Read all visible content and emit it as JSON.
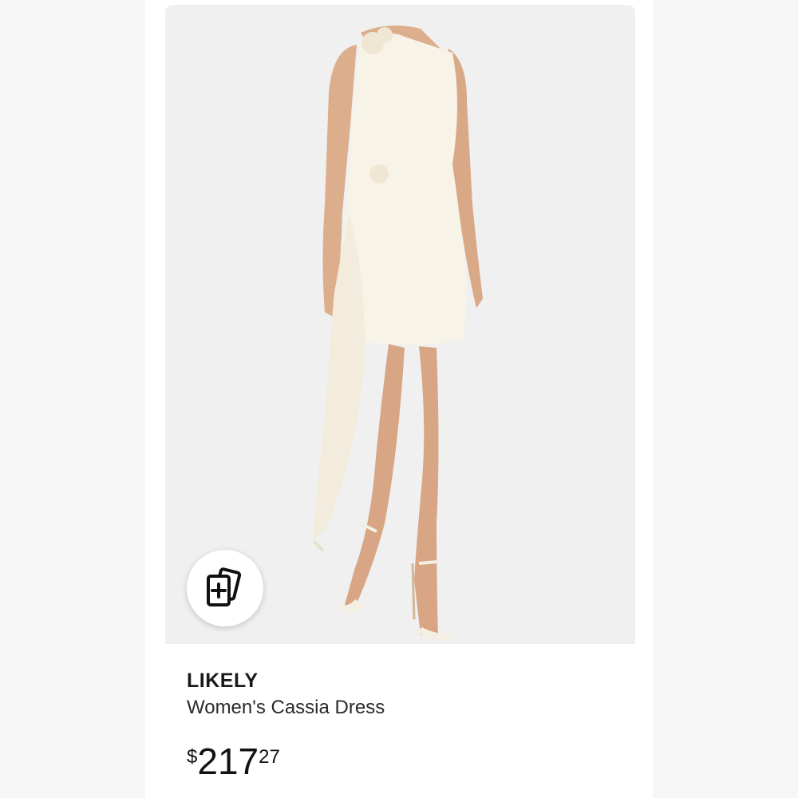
{
  "product": {
    "brand": "LIKELY",
    "title": "Women's Cassia Dress",
    "price": {
      "currency_symbol": "$",
      "dollars": "217",
      "cents": "27"
    }
  },
  "actions": {
    "add_to_list_icon": "add-card-icon"
  },
  "colors": {
    "image_background": "#f0f0f0",
    "dress": "#f7f2e6",
    "text_primary": "#1a1a1a"
  }
}
